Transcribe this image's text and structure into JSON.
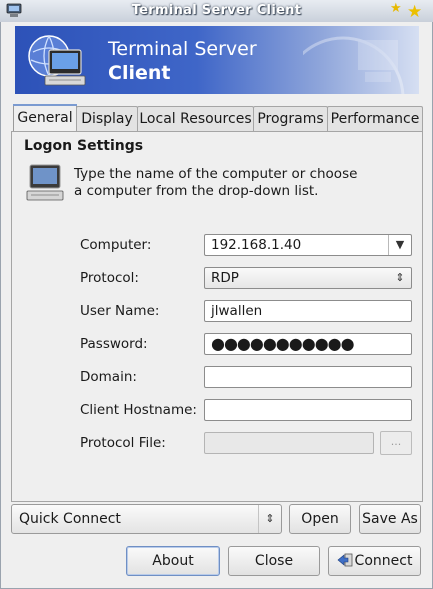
{
  "window": {
    "title": "Terminal Server Client"
  },
  "banner": {
    "line1": "Terminal Server",
    "line2": "Client"
  },
  "tabs": [
    {
      "label": "General",
      "active": true
    },
    {
      "label": "Display",
      "active": false
    },
    {
      "label": "Local Resources",
      "active": false
    },
    {
      "label": "Programs",
      "active": false
    },
    {
      "label": "Performance",
      "active": false
    }
  ],
  "logon": {
    "heading": "Logon Settings",
    "description_line1": "Type the name of the computer or choose",
    "description_line2": "a computer from the drop-down list."
  },
  "fields": {
    "computer": {
      "label": "Computer:",
      "value": "192.168.1.40"
    },
    "protocol": {
      "label": "Protocol:",
      "value": "RDP"
    },
    "username": {
      "label": "User Name:",
      "value": "jlwallen"
    },
    "password": {
      "label": "Password:",
      "value": "●●●●●●●●●●●"
    },
    "domain": {
      "label": "Domain:",
      "value": ""
    },
    "client_hostname": {
      "label": "Client Hostname:",
      "value": ""
    },
    "protocol_file": {
      "label": "Protocol File:",
      "value": "",
      "browse_label": "..."
    }
  },
  "bottom": {
    "quick_connect": "Quick Connect",
    "open": "Open",
    "save_as": "Save As",
    "about": "About",
    "close": "Close",
    "connect": "Connect"
  }
}
